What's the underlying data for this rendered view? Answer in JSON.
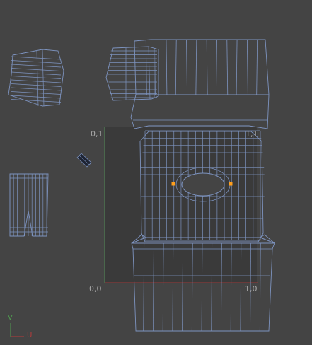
{
  "uv_editor": {
    "corner_labels": {
      "top_left": "0,1",
      "top_right": "1,1",
      "bottom_left": "0,0",
      "bottom_right": "1,0"
    },
    "axis_gizmo": {
      "v": "V",
      "u": "U"
    },
    "colors": {
      "background": "#444444",
      "uv_square": "#3a3a3a",
      "mesh_line": "#7d93bf",
      "mesh_edge_dark": "#1e2433",
      "selected_vertex": "#ff9f1c",
      "axis_v": "#4f9a4f",
      "axis_u": "#b83a3a"
    }
  }
}
